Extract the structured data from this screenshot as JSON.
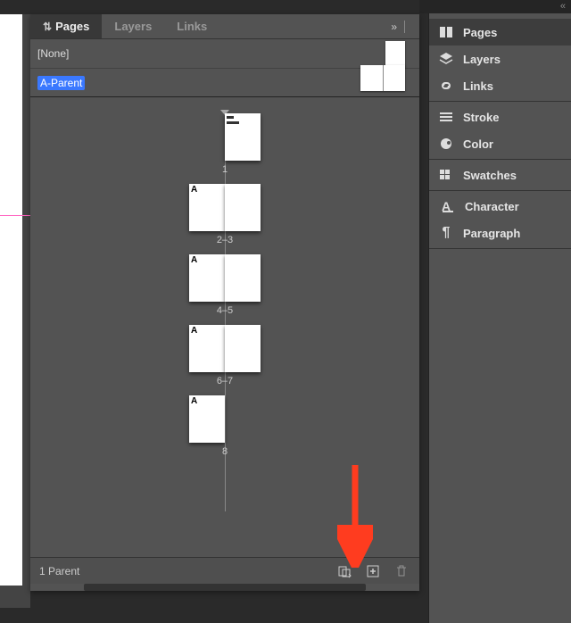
{
  "topbar": {
    "collapse_glyph": "«"
  },
  "tabs": {
    "pages": "Pages",
    "layers": "Layers",
    "links": "Links",
    "overflow_glyph": "»"
  },
  "parents": {
    "none_label": "[None]",
    "a_parent_label": "A-Parent"
  },
  "spreads": [
    {
      "label": "1",
      "layout": "single-right",
      "pages": [
        {
          "letter": "",
          "has_art": true
        }
      ]
    },
    {
      "label": "2–3",
      "layout": "facing",
      "pages": [
        {
          "letter": "A"
        },
        {
          "letter": ""
        }
      ]
    },
    {
      "label": "4–5",
      "layout": "facing",
      "pages": [
        {
          "letter": "A"
        },
        {
          "letter": ""
        }
      ]
    },
    {
      "label": "6–7",
      "layout": "facing",
      "pages": [
        {
          "letter": "A"
        },
        {
          "letter": ""
        }
      ]
    },
    {
      "label": "8",
      "layout": "single-left",
      "pages": [
        {
          "letter": "A"
        }
      ]
    }
  ],
  "footer": {
    "status": "1 Parent"
  },
  "right_panel": [
    {
      "group": 0,
      "icon": "pages-icon",
      "label": "Pages",
      "active": true
    },
    {
      "group": 0,
      "icon": "layers-icon",
      "label": "Layers",
      "active": false
    },
    {
      "group": 0,
      "icon": "links-icon",
      "label": "Links",
      "active": false
    },
    {
      "group": 1,
      "icon": "stroke-icon",
      "label": "Stroke",
      "active": false
    },
    {
      "group": 1,
      "icon": "color-icon",
      "label": "Color",
      "active": false
    },
    {
      "group": 2,
      "icon": "swatches-icon",
      "label": "Swatches",
      "active": false
    },
    {
      "group": 3,
      "icon": "character-icon",
      "label": "Character",
      "active": false
    },
    {
      "group": 3,
      "icon": "paragraph-icon",
      "label": "Paragraph",
      "active": false
    }
  ],
  "callout": {
    "color": "#ff3c1f"
  }
}
